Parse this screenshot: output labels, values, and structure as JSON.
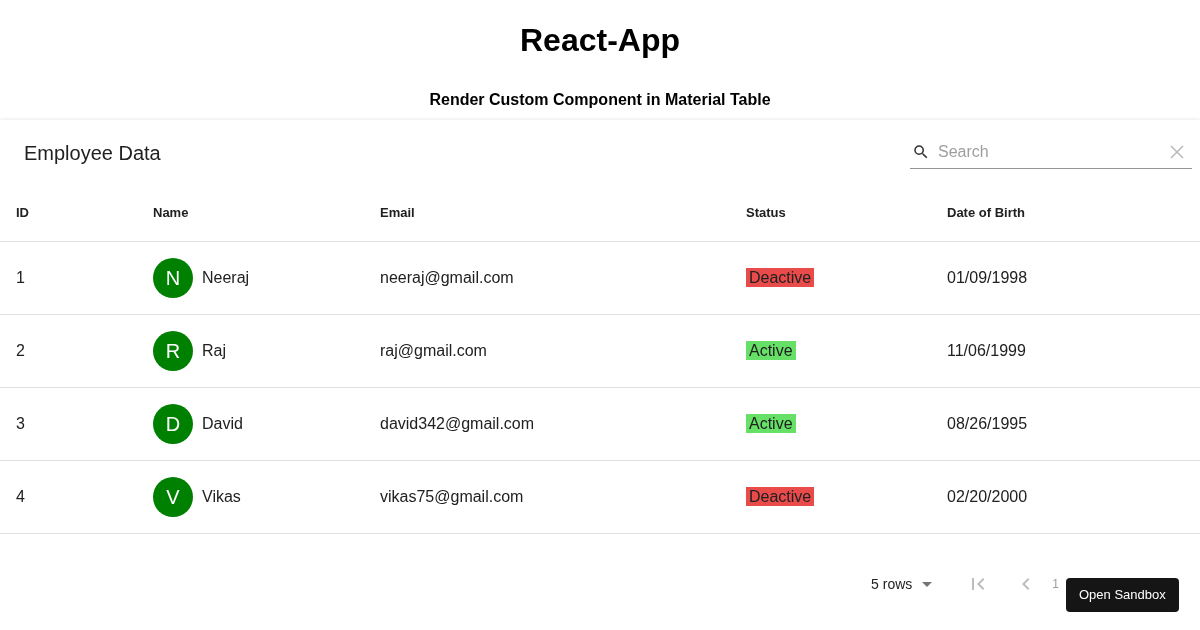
{
  "page": {
    "title": "React-App",
    "subtitle": "Render Custom Component in Material Table"
  },
  "table": {
    "title": "Employee Data",
    "search": {
      "placeholder": "Search"
    },
    "columns": [
      "ID",
      "Name",
      "Email",
      "Status",
      "Date of Birth"
    ],
    "rows": [
      {
        "id": "1",
        "initial": "N",
        "name": "Neeraj",
        "email": "neeraj@gmail.com",
        "status": "Deactive",
        "kind": "inactive",
        "dob": "01/09/1998"
      },
      {
        "id": "2",
        "initial": "R",
        "name": "Raj",
        "email": "raj@gmail.com",
        "status": "Active",
        "kind": "active",
        "dob": "11/06/1999"
      },
      {
        "id": "3",
        "initial": "D",
        "name": "David",
        "email": "david342@gmail.com",
        "status": "Active",
        "kind": "active",
        "dob": "08/26/1995"
      },
      {
        "id": "4",
        "initial": "V",
        "name": "Vikas",
        "email": "vikas75@gmail.com",
        "status": "Deactive",
        "kind": "inactive",
        "dob": "02/20/2000"
      }
    ],
    "pagination": {
      "rows_per_page": "5 rows",
      "page_info": "1"
    }
  },
  "tooltip": "Open Sandbox"
}
